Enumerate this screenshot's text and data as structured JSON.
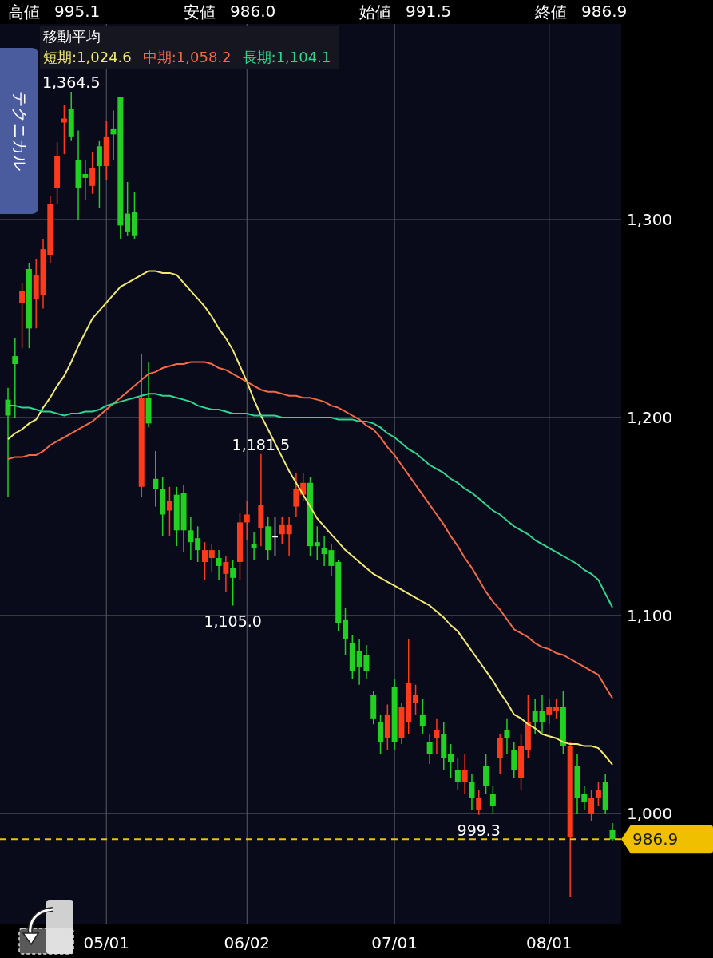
{
  "header": {
    "stats": [
      {
        "label": "高値",
        "value": "995.1"
      },
      {
        "label": "安値",
        "value": "986.0"
      },
      {
        "label": "始値",
        "value": "991.5"
      },
      {
        "label": "終値",
        "value": "986.9"
      }
    ]
  },
  "legend": {
    "title": "移動平均",
    "items": [
      {
        "label": "短期:1,024.6",
        "color": "#f2ea6c"
      },
      {
        "label": "中期:1,058.2",
        "color": "#f26a45"
      },
      {
        "label": "長期:1,104.1",
        "color": "#2fd68f"
      }
    ]
  },
  "side_tab": {
    "label": "テクニカル"
  },
  "chart": {
    "chart_data": {
      "type": "candlestick",
      "ylim": [
        943.9,
        1398.8
      ],
      "grid": true,
      "ref_lines": [
        {
          "axis": "y",
          "value": 986.9,
          "label": "986.9",
          "color": "#f0c000"
        }
      ],
      "categories": [
        null,
        null,
        null,
        null,
        null,
        null,
        null,
        null,
        null,
        null,
        null,
        null,
        null,
        null,
        "05/01",
        null,
        null,
        null,
        null,
        null,
        null,
        null,
        null,
        null,
        null,
        null,
        null,
        null,
        null,
        null,
        null,
        null,
        null,
        null,
        "06/02",
        null,
        null,
        null,
        null,
        null,
        null,
        null,
        null,
        null,
        null,
        null,
        null,
        null,
        null,
        null,
        null,
        null,
        null,
        null,
        null,
        "07/01",
        null,
        null,
        null,
        null,
        null,
        null,
        null,
        null,
        null,
        null,
        null,
        null,
        null,
        null,
        null,
        null,
        null,
        null,
        null,
        null,
        null,
        "08/01",
        null,
        null,
        null,
        null,
        null,
        null,
        null,
        null,
        null
      ],
      "yticks": [
        {
          "value": 1000,
          "label": "1,000"
        },
        {
          "value": 1100,
          "label": "1,100"
        },
        {
          "value": 1200,
          "label": "1,200"
        },
        {
          "value": 1300,
          "label": "1,300"
        }
      ],
      "ohlc": [
        [
          1209,
          1215,
          1160,
          1201
        ],
        [
          1231,
          1240,
          1200,
          1227
        ],
        [
          1258,
          1268,
          1235,
          1264
        ],
        [
          1275,
          1278,
          1235,
          1245
        ],
        [
          1260,
          1280,
          1245,
          1272
        ],
        [
          1262,
          1290,
          1255,
          1285
        ],
        [
          1282,
          1312,
          1278,
          1308
        ],
        [
          1316,
          1339,
          1308,
          1332
        ],
        [
          1349,
          1358,
          1333,
          1351
        ],
        [
          1356,
          1364.5,
          1340,
          1342
        ],
        [
          1330,
          1345,
          1300,
          1316
        ],
        [
          1323,
          1330,
          1310,
          1321
        ],
        [
          1317,
          1334,
          1313,
          1326
        ],
        [
          1337,
          1340,
          1306,
          1327
        ],
        [
          1327,
          1350,
          1320,
          1342
        ],
        [
          1346,
          1355,
          1330,
          1343
        ],
        [
          1362,
          1362,
          1290,
          1297
        ],
        [
          1303,
          1319,
          1292,
          1294
        ],
        [
          1304,
          1314,
          1290,
          1292
        ],
        [
          1165,
          1232,
          1160,
          1210
        ],
        [
          1210,
          1228,
          1195,
          1197
        ],
        [
          1169,
          1183,
          1155,
          1164
        ],
        [
          1164,
          1170,
          1140,
          1151
        ],
        [
          1153,
          1165,
          1140,
          1158
        ],
        [
          1161,
          1165,
          1135,
          1143
        ],
        [
          1162,
          1166,
          1132,
          1143
        ],
        [
          1143,
          1150,
          1128,
          1137
        ],
        [
          1139,
          1145,
          1127,
          1133
        ],
        [
          1127,
          1137,
          1118,
          1133
        ],
        [
          1129,
          1136,
          1122,
          1133
        ],
        [
          1129,
          1133,
          1118,
          1125
        ],
        [
          1121,
          1130,
          1112,
          1127
        ],
        [
          1124,
          1128,
          1105,
          1119
        ],
        [
          1127,
          1152,
          1118,
          1147
        ],
        [
          1147,
          1158,
          1138,
          1151
        ],
        [
          1136,
          1142,
          1128,
          1134
        ],
        [
          1144,
          1181.5,
          1135,
          1156
        ],
        [
          1145,
          1150,
          1128,
          1133
        ],
        [
          1140,
          1150,
          1130,
          1140
        ],
        [
          1141,
          1150,
          1136,
          1146
        ],
        [
          1141,
          1150,
          1130,
          1146
        ],
        [
          1155,
          1172,
          1150,
          1164
        ],
        [
          1161,
          1172,
          1158,
          1167
        ],
        [
          1167,
          1170,
          1130,
          1135
        ],
        [
          1137,
          1145,
          1128,
          1135
        ],
        [
          1134,
          1140,
          1125,
          1131
        ],
        [
          1133,
          1136,
          1120,
          1125
        ],
        [
          1127,
          1128,
          1092,
          1096
        ],
        [
          1098,
          1104,
          1080,
          1088
        ],
        [
          1086,
          1090,
          1068,
          1072
        ],
        [
          1082,
          1088,
          1065,
          1074
        ],
        [
          1080,
          1085,
          1068,
          1072
        ],
        [
          1060,
          1062,
          1045,
          1048
        ],
        [
          1046,
          1050,
          1030,
          1036
        ],
        [
          1038,
          1055,
          1032,
          1050
        ],
        [
          1064,
          1068,
          1032,
          1036
        ],
        [
          1038,
          1056,
          1035,
          1054
        ],
        [
          1046,
          1088,
          1040,
          1066
        ],
        [
          1056,
          1065,
          1050,
          1060
        ],
        [
          1050,
          1058,
          1040,
          1044
        ],
        [
          1036,
          1040,
          1025,
          1030
        ],
        [
          1038,
          1048,
          1030,
          1042
        ],
        [
          1040,
          1046,
          1022,
          1028
        ],
        [
          1030,
          1035,
          1018,
          1026
        ],
        [
          1022,
          1028,
          1012,
          1016
        ],
        [
          1016,
          1030,
          1010,
          1022
        ],
        [
          1016,
          1020,
          1002,
          1008
        ],
        [
          1002,
          1012,
          999.3,
          1008
        ],
        [
          1024,
          1030,
          1010,
          1014
        ],
        [
          1010,
          1014,
          1000,
          1004
        ],
        [
          1028,
          1040,
          1020,
          1038
        ],
        [
          1042,
          1048,
          1030,
          1038
        ],
        [
          1032,
          1036,
          1018,
          1022
        ],
        [
          1018,
          1040,
          1012,
          1034
        ],
        [
          1032,
          1060,
          1028,
          1046
        ],
        [
          1052,
          1058,
          1040,
          1046
        ],
        [
          1052,
          1060,
          1040,
          1046
        ],
        [
          1050,
          1058,
          1045,
          1054
        ],
        [
          1052,
          1058,
          1048,
          1054
        ],
        [
          1054,
          1062,
          1030,
          1034
        ],
        [
          988,
          1036,
          958,
          1034
        ],
        [
          1024,
          1030,
          1000,
          1008
        ],
        [
          1010,
          1014,
          1002,
          1006
        ],
        [
          1000,
          1012,
          996,
          1008
        ],
        [
          1008,
          1016,
          1004,
          1012
        ],
        [
          1016,
          1020,
          1000,
          1002
        ],
        [
          991.5,
          995.1,
          986.0,
          986.9
        ]
      ],
      "series": [
        {
          "type": "line",
          "color": "#f2ea6c",
          "values": [
            1189,
            1192,
            1194,
            1197,
            1199,
            1205,
            1210,
            1216,
            1221,
            1228,
            1236,
            1243,
            1250,
            1254,
            1258,
            1262,
            1266,
            1268,
            1270,
            1272,
            1274,
            1274,
            1273,
            1273,
            1272,
            1268,
            1264,
            1260,
            1256,
            1251,
            1245,
            1240,
            1234,
            1226,
            1218,
            1209,
            1201,
            1194,
            1187,
            1180,
            1173,
            1167,
            1161,
            1155,
            1149,
            1145,
            1141,
            1137,
            1133,
            1130,
            1127,
            1124,
            1121,
            1119,
            1117,
            1115,
            1113,
            1111,
            1109,
            1107,
            1105,
            1102,
            1099,
            1095,
            1092,
            1087,
            1082,
            1077,
            1072,
            1067,
            1061,
            1056,
            1050,
            1048,
            1045,
            1043,
            1040,
            1039,
            1038,
            1036,
            1035,
            1035,
            1034,
            1034,
            1033,
            1029,
            1024.6
          ]
        },
        {
          "type": "line",
          "color": "#f26a45",
          "values": [
            1179,
            1180,
            1180,
            1181,
            1181,
            1183,
            1186,
            1188,
            1190,
            1192,
            1194,
            1196,
            1198,
            1201,
            1204,
            1207,
            1210,
            1213,
            1216,
            1219,
            1222,
            1223,
            1225,
            1226,
            1227,
            1227,
            1228,
            1228,
            1228,
            1227,
            1225,
            1224,
            1222,
            1220,
            1218,
            1216,
            1214,
            1213,
            1213,
            1212,
            1211,
            1211,
            1210,
            1210,
            1209,
            1208,
            1206,
            1205,
            1203,
            1201,
            1199,
            1196,
            1194,
            1190,
            1185,
            1181,
            1176,
            1171,
            1166,
            1161,
            1156,
            1151,
            1146,
            1140,
            1135,
            1129,
            1124,
            1118,
            1112,
            1107,
            1103,
            1098,
            1093,
            1091,
            1089,
            1086,
            1084,
            1083,
            1081,
            1080,
            1078,
            1076,
            1074,
            1072,
            1070,
            1064,
            1058.2
          ]
        },
        {
          "type": "line",
          "color": "#2fd68f",
          "values": [
            1206,
            1206,
            1205,
            1205,
            1204,
            1203,
            1203,
            1202,
            1201,
            1202,
            1202,
            1203,
            1203,
            1204,
            1206,
            1207,
            1208,
            1209,
            1210,
            1211,
            1212,
            1212,
            1211,
            1211,
            1210,
            1209,
            1208,
            1206,
            1205,
            1204,
            1204,
            1203,
            1202,
            1202,
            1202,
            1201,
            1201,
            1201,
            1201,
            1200,
            1200,
            1200,
            1200,
            1200,
            1200,
            1200,
            1200,
            1199,
            1199,
            1199,
            1198,
            1198,
            1197,
            1195,
            1192,
            1190,
            1187,
            1184,
            1182,
            1179,
            1176,
            1174,
            1172,
            1169,
            1167,
            1164,
            1162,
            1159,
            1156,
            1153,
            1151,
            1148,
            1145,
            1143,
            1141,
            1138,
            1136,
            1134,
            1132,
            1130,
            1128,
            1126,
            1123,
            1121,
            1118,
            1111,
            1104.1
          ]
        }
      ],
      "annotations": [
        {
          "text": "1,364.5",
          "y": 1364.5
        },
        {
          "text": "1,181.5",
          "y": 1181.5
        },
        {
          "text": "1,105.0",
          "y": 1105
        },
        {
          "text": "999.3",
          "y": 999.3
        }
      ]
    }
  }
}
